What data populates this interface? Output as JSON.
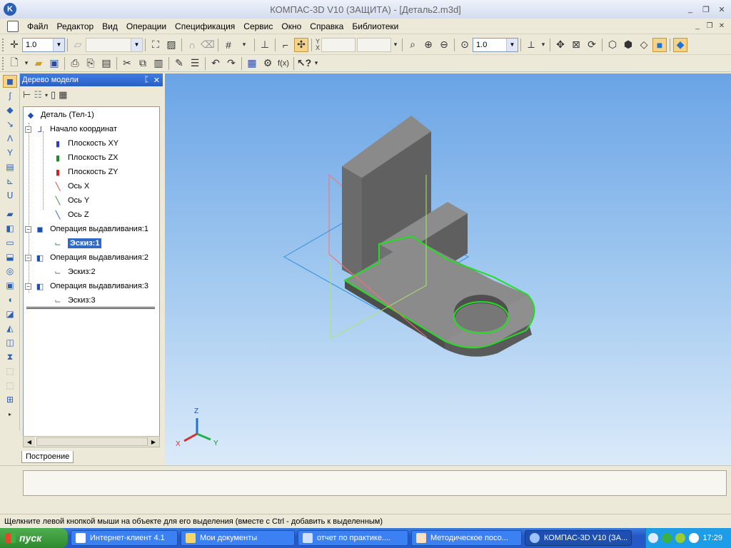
{
  "window": {
    "title": "КОМПАС-3D V10 (ЗАЩИТА) - [Деталь2.m3d]",
    "app_icon_letter": "K",
    "minimize": "_",
    "restore": "❐",
    "close": "✕"
  },
  "menu": {
    "items": [
      "Файл",
      "Редактор",
      "Вид",
      "Операции",
      "Спецификация",
      "Сервис",
      "Окно",
      "Справка",
      "Библиотеки"
    ]
  },
  "toolbar1": {
    "step_value": "1.0",
    "layer_value": "",
    "coord_label_top": "Y",
    "coord_label_bottom": "X",
    "zoom_value": "1.0"
  },
  "tree_panel": {
    "title": "Дерево модели",
    "pin": "ᛈ",
    "close": "✕",
    "tab_label": "Построение",
    "nodes": [
      {
        "label": "Деталь (Тел-1)"
      },
      {
        "label": "Начало координат"
      },
      {
        "label": "Плоскость XY"
      },
      {
        "label": "Плоскость ZX"
      },
      {
        "label": "Плоскость ZY"
      },
      {
        "label": "Ось X"
      },
      {
        "label": "Ось Y"
      },
      {
        "label": "Ось Z"
      },
      {
        "label": "Операция выдавливания:1"
      },
      {
        "label": "Эскиз:1"
      },
      {
        "label": "Операция выдавливания:2"
      },
      {
        "label": "Эскиз:2"
      },
      {
        "label": "Операция выдавливания:3"
      },
      {
        "label": "Эскиз:3"
      }
    ]
  },
  "viewport": {
    "axis_x": "X",
    "axis_y": "Y",
    "axis_z": "Z",
    "highlight_color": "#22dd22"
  },
  "status": {
    "text": "Щелкните левой кнопкой мыши на объекте для его выделения (вместе с Ctrl - добавить к выделенным)"
  },
  "taskbar": {
    "start": "пуск",
    "tasks": [
      "Интернет-клиент 4.1",
      "Мои документы",
      "отчет по практике....",
      "Методическое посо...",
      "КОМПАС-3D V10 (ЗА..."
    ],
    "clock": "17:29"
  }
}
